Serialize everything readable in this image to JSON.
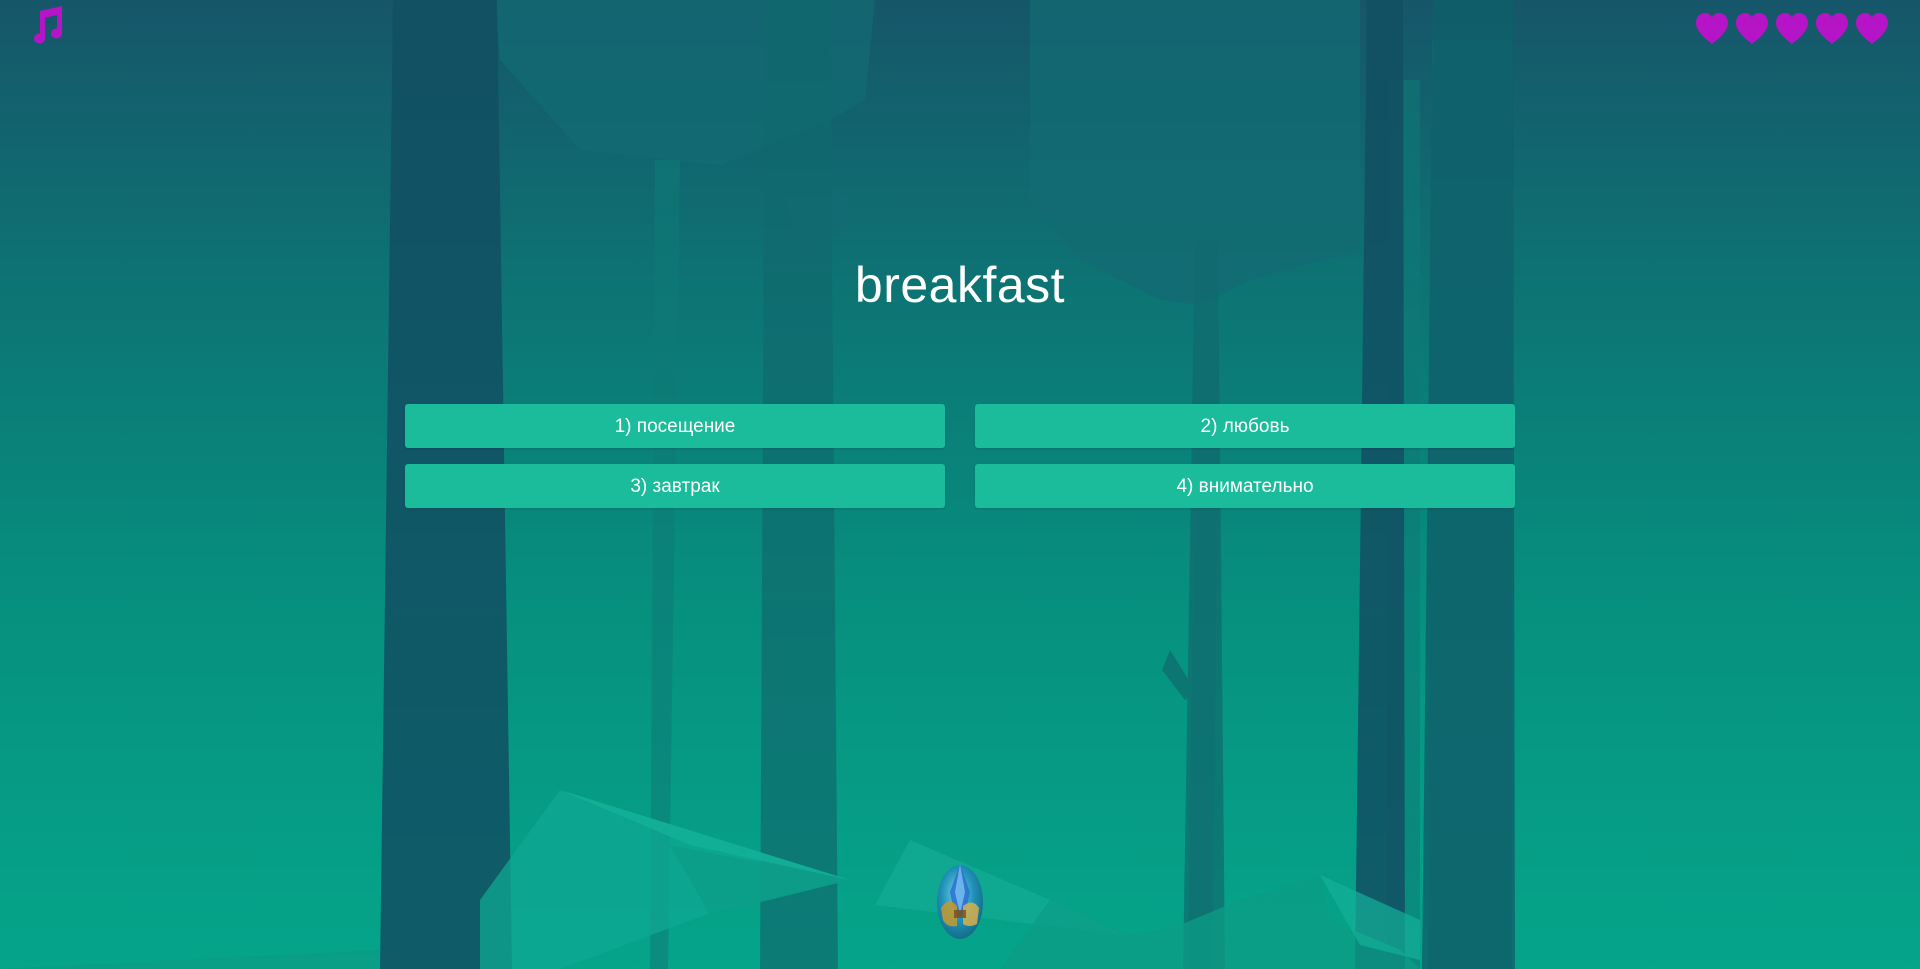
{
  "quiz": {
    "word": "breakfast",
    "answers": [
      {
        "label": "1) посещение"
      },
      {
        "label": "2) любовь"
      },
      {
        "label": "3) завтрак"
      },
      {
        "label": "4) внимательно"
      }
    ]
  },
  "lives": {
    "count": 5,
    "max": 5,
    "icon": "heart-icon",
    "color": "#b514c7"
  },
  "toolbar": {
    "music_icon": "music-note-icon",
    "music_color": "#b514c7"
  },
  "mascot": {
    "icon": "egg-avatar-icon"
  },
  "theme": {
    "answer_button_color": "#1abc9c",
    "text_color": "#ffffff"
  }
}
